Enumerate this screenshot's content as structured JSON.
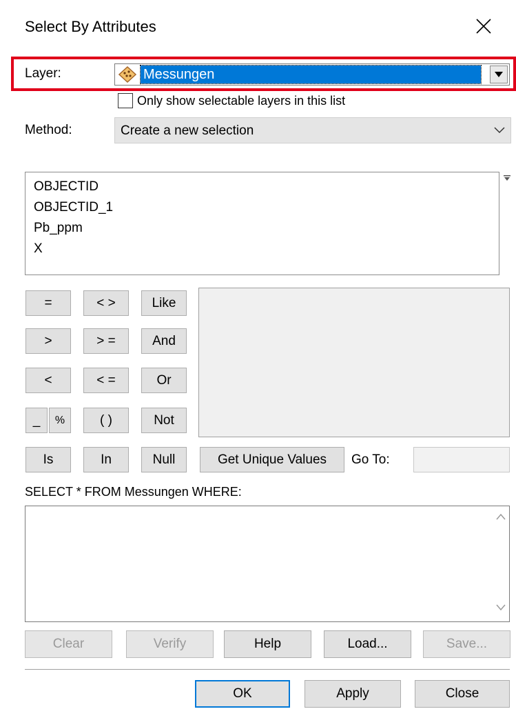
{
  "dialog": {
    "title": "Select By Attributes"
  },
  "layer": {
    "label": "Layer:",
    "value": "Messungen",
    "checkbox_label": "Only show selectable layers in this list",
    "checkbox_checked": false
  },
  "method": {
    "label": "Method:",
    "value": "Create a new selection"
  },
  "fields": [
    "OBJECTID",
    "OBJECTID_1",
    "Pb_ppm",
    "X"
  ],
  "operators": {
    "eq": "=",
    "ne": "< >",
    "like": "Like",
    "gt": ">",
    "ge": "> =",
    "and": "And",
    "lt": "<",
    "le": "< =",
    "or": "Or",
    "underscore": "_",
    "percent": "%",
    "parens": "( )",
    "not": "Not",
    "is": "Is",
    "in": "In",
    "null": "Null"
  },
  "unique": {
    "button": "Get Unique Values",
    "goto_label": "Go To:",
    "goto_value": ""
  },
  "query": {
    "label": "SELECT * FROM Messungen WHERE:",
    "value": ""
  },
  "actions": {
    "clear": "Clear",
    "verify": "Verify",
    "help": "Help",
    "load": "Load...",
    "save": "Save..."
  },
  "footer": {
    "ok": "OK",
    "apply": "Apply",
    "close": "Close"
  },
  "colors": {
    "highlight": "#e0001a",
    "selection": "#0078d7",
    "accent_border": "#0078d7"
  }
}
